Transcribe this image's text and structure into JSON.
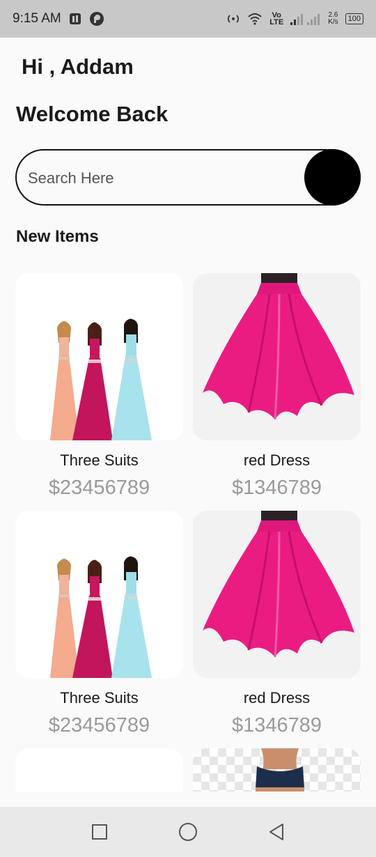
{
  "status_bar": {
    "time": "9:15 AM",
    "network_speed_value": "2.6",
    "network_speed_unit": "K/s",
    "network_label_top": "Vo",
    "network_label_bottom": "LTE",
    "battery": "100"
  },
  "header": {
    "greeting": "Hi , Addam",
    "welcome": "Welcome Back"
  },
  "search": {
    "placeholder": "Search Here"
  },
  "section": {
    "title": "New Items"
  },
  "products": [
    {
      "name": "Three Suits",
      "price": "$23456789",
      "image": "three-gowns"
    },
    {
      "name": "red Dress",
      "price": "$1346789",
      "image": "pink-skirt"
    },
    {
      "name": "Three Suits",
      "price": "$23456789",
      "image": "three-gowns"
    },
    {
      "name": "red Dress",
      "price": "$1346789",
      "image": "pink-skirt"
    }
  ],
  "partial_products": [
    {
      "image": "white-item"
    },
    {
      "image": "navy-top"
    }
  ],
  "icons": {
    "search_button": "search-button",
    "nav": [
      "recent-apps-icon",
      "home-icon",
      "back-icon"
    ]
  },
  "colors": {
    "accent": "#000000",
    "price": "#9a9a9a",
    "pink": "#e8157a",
    "status_bar": "#c8c8c8",
    "nav_bar": "#e9e9e9"
  }
}
